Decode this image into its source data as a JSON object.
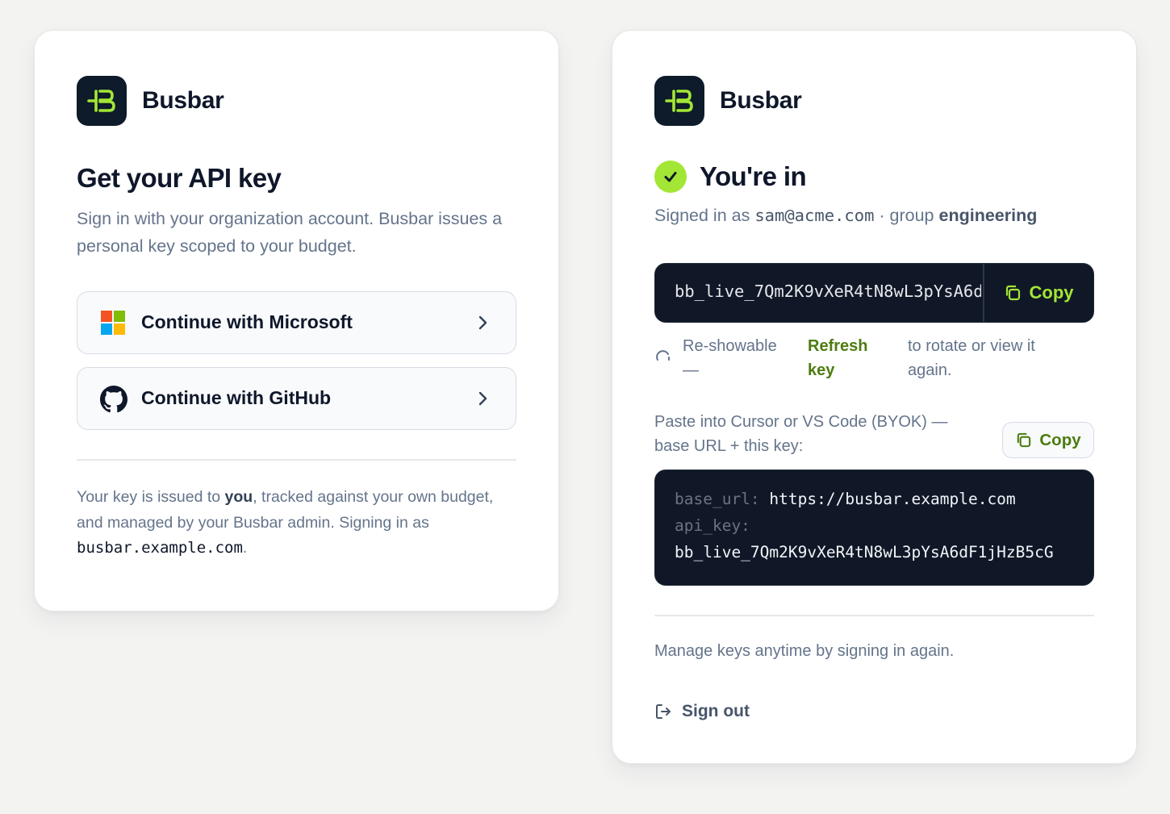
{
  "login": {
    "brand": "Busbar",
    "logo_icon": "busbar-logo-icon",
    "title": "Get your API key",
    "subtitle": "Sign in with your organization account. Busbar issues a personal key scoped to your budget.",
    "providers": [
      {
        "label": "Continue with Microsoft",
        "icon": "microsoft-logo-icon"
      },
      {
        "label": "Continue with GitHub",
        "icon": "github-logo-icon"
      }
    ],
    "note_part1": "Your key is issued to ",
    "note_bold": "you",
    "note_part2": ", tracked against your own budget, and managed by your Busbar admin. Signing in as ",
    "note_domain": "busbar.example.com",
    "note_end": "."
  },
  "success": {
    "brand": "Busbar",
    "title": "You're in",
    "signed_prefix": "Signed in as ",
    "email": "sam@acme.com",
    "group_prefix": " · group ",
    "group": "engineering",
    "api_key": "bb_live_7Qm2K9vXeR4tN8wL3pYsA6dF1jHzB5cG",
    "copy_label": "Copy",
    "hint_a": "Re-showable —",
    "hint_link": "Refresh key",
    "hint_c": "to rotate or view it again.",
    "paste_text": "Paste into Cursor or VS Code (BYOK) — base URL + this key:",
    "copy_label_2": "Copy",
    "base_url_key": "base_url:",
    "base_url": "https://busbar.example.com",
    "api_key_key": "api_key:",
    "manage_text": "Manage keys anytime by signing in again.",
    "signout_label": "Sign out"
  },
  "colors": {
    "accent": "#a3e635",
    "link_green": "#4d7c0f",
    "dark": "#101827"
  }
}
